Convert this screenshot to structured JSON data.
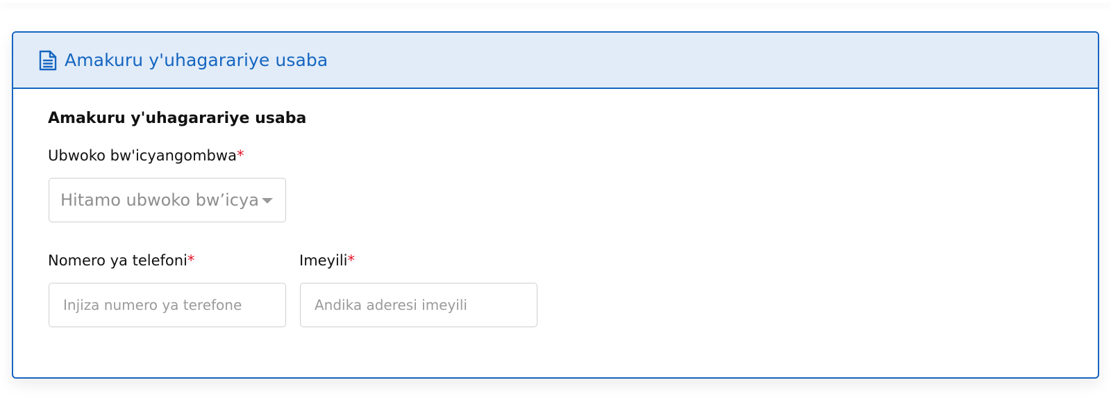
{
  "panel": {
    "header_title": "Amakuru y'uhagarariye usaba",
    "header_icon": "document-icon",
    "accent_color": "#1565c0",
    "header_bg": "#e1ecf8"
  },
  "section": {
    "title": "Amakuru y'uhagarariye usaba"
  },
  "fields": {
    "nationality": {
      "label": "Ubwoko bw'icyangombwa",
      "required_mark": "*",
      "placeholder": "Hitamo ubwoko bw’icyangombwa"
    },
    "phone": {
      "label": "Nomero ya telefoni",
      "required_mark": "*",
      "placeholder": "Injiza numero ya terefone"
    },
    "email": {
      "label": "Imeyili",
      "required_mark": "*",
      "placeholder": "Andika aderesi imeyili"
    }
  }
}
